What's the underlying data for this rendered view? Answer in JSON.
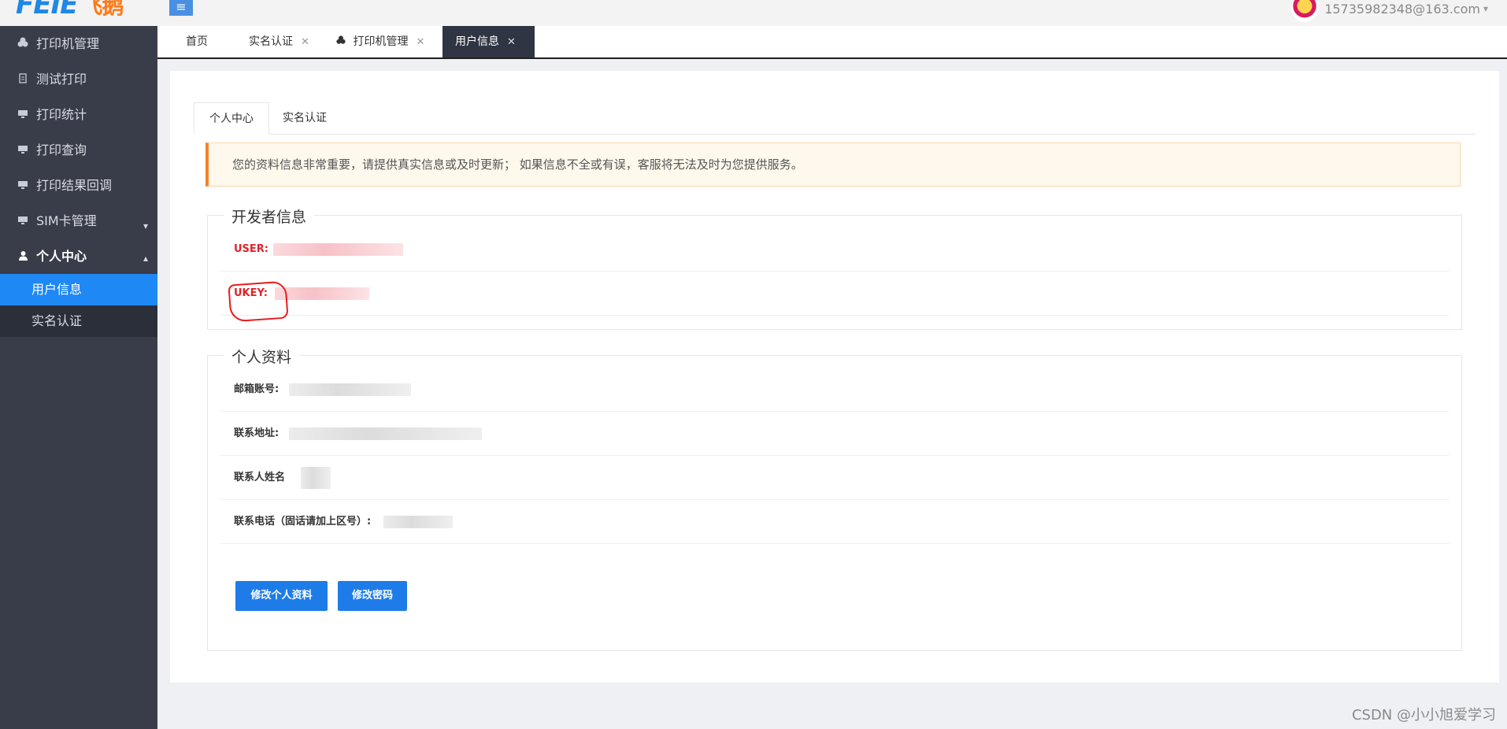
{
  "header": {
    "logo_text": "FEIE",
    "logo_cn": "飞鹅",
    "menu_toggle_icon": "≡",
    "user_email": "15735982348@163.com",
    "user_caret_icon": "▾"
  },
  "sidebar": {
    "items": [
      {
        "label": "打印机管理",
        "icon": "printer-group-icon"
      },
      {
        "label": "测试打印",
        "icon": "file-icon"
      },
      {
        "label": "打印统计",
        "icon": "monitor-icon"
      },
      {
        "label": "打印查询",
        "icon": "monitor-icon"
      },
      {
        "label": "打印结果回调",
        "icon": "monitor-icon"
      },
      {
        "label": "SIM卡管理",
        "icon": "monitor-icon",
        "arrow": "▾"
      },
      {
        "label": "个人中心",
        "icon": "user-icon",
        "arrow": "▴"
      }
    ],
    "sub_items": [
      {
        "label": "用户信息",
        "active": true
      },
      {
        "label": "实名认证",
        "active": false
      }
    ]
  },
  "tabs": [
    {
      "label": "首页",
      "closable": false
    },
    {
      "label": "实名认证",
      "closable": true
    },
    {
      "label": "打印机管理",
      "closable": true
    },
    {
      "label": "用户信息",
      "closable": true,
      "active": true
    }
  ],
  "tab_close_glyph": "✕",
  "inner_tabs": [
    {
      "label": "个人中心",
      "active": true
    },
    {
      "label": "实名认证",
      "active": false
    }
  ],
  "notice": "您的资料信息非常重要，请提供真实信息或及时更新；  如果信息不全或有误，客服将无法及时为您提供服务。",
  "developer_info": {
    "title": "开发者信息",
    "user_label": "USER:",
    "ukey_label": "UKEY:"
  },
  "profile": {
    "title": "个人资料",
    "email_label": "邮箱账号:",
    "address_label": "联系地址:",
    "contact_name_label": "联系人姓名",
    "phone_label": "联系电话（固话请加上区号）:"
  },
  "buttons": {
    "edit_profile": "修改个人资料",
    "change_password": "修改密码"
  },
  "watermark": "CSDN @小小旭爱学习",
  "colors": {
    "sidebar_bg": "#393d49",
    "active_blue": "#1e88f5",
    "button_blue": "#1e7ce8",
    "notice_accent": "#f5812a",
    "dev_label_red": "#e0222a"
  }
}
